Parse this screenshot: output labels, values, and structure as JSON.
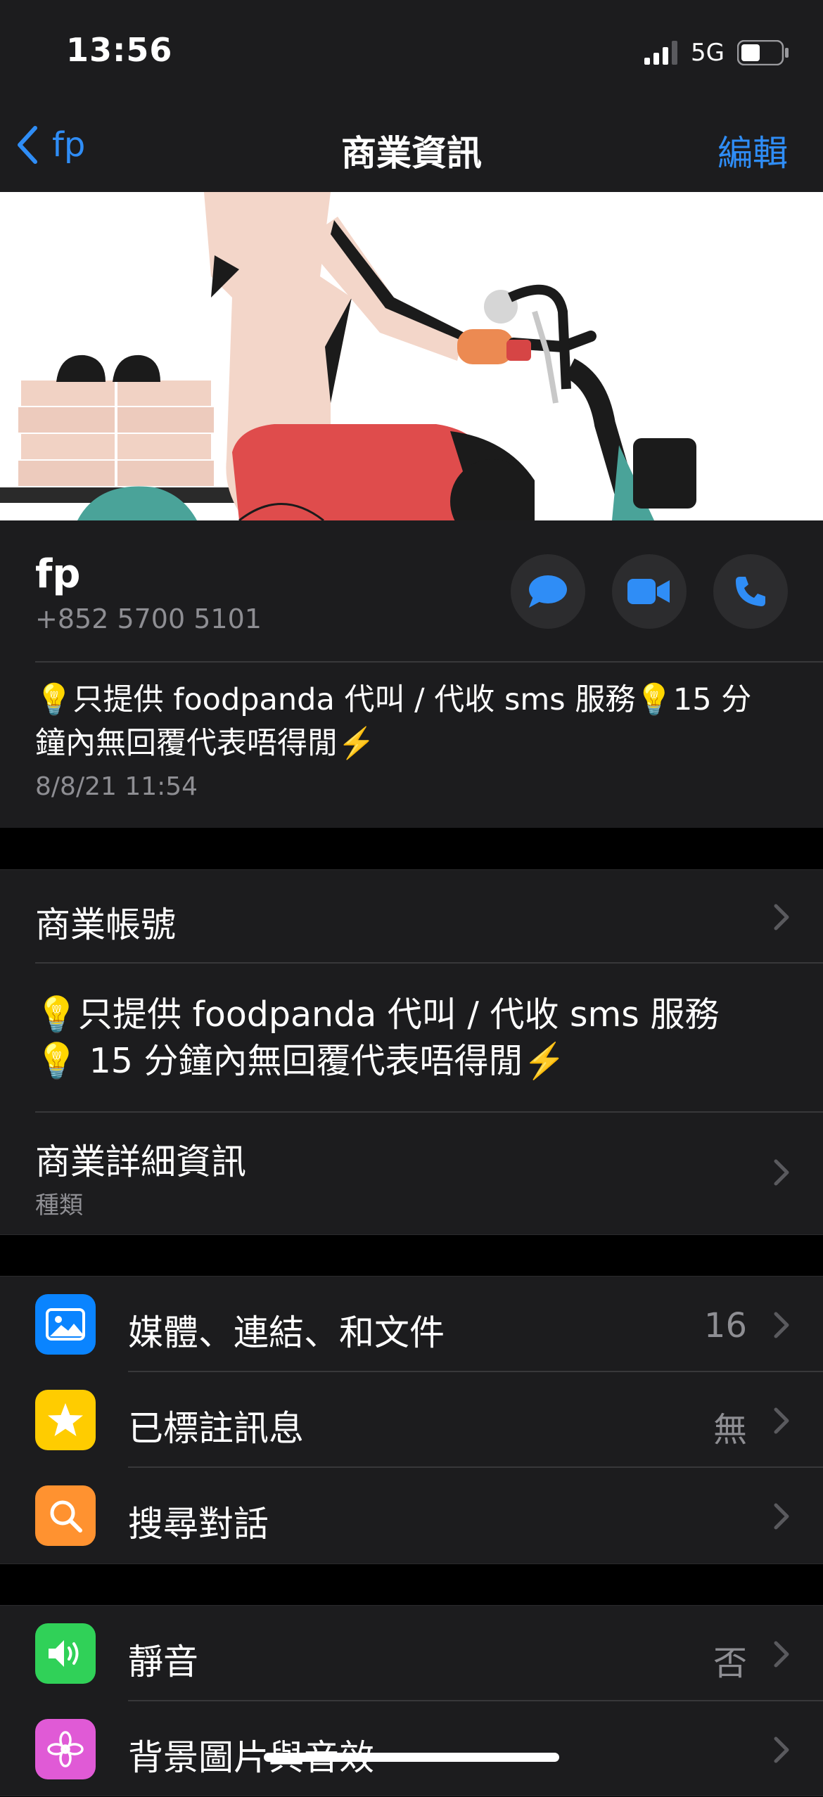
{
  "status_bar": {
    "time": "13:56",
    "network": "5G"
  },
  "nav": {
    "back_label": "fp",
    "title": "商業資訊",
    "edit_label": "編輯"
  },
  "contact": {
    "name": "fp",
    "phone": "+852 5700 5101",
    "about": "💡只提供 foodpanda 代叫 / 代收 sms 服務💡15 分鐘內無回覆代表唔得閒⚡️",
    "about_date": "8/8/21 11:54",
    "actions": [
      "message-icon",
      "video-call-icon",
      "phone-icon"
    ]
  },
  "business": {
    "account_label": "商業帳號",
    "description": "💡只提供 foodpanda 代叫 / 代收 sms 服務💡 15 分鐘內無回覆代表唔得閒⚡️",
    "details_label": "商業詳細資訊",
    "details_sub": "種類"
  },
  "chat_items": [
    {
      "label": "媒體、連結、和文件",
      "value": "16",
      "icon": "photo-icon",
      "color": "#0a84ff"
    },
    {
      "label": "已標註訊息",
      "value": "無",
      "icon": "star-icon",
      "color": "#ffcc00"
    },
    {
      "label": "搜尋對話",
      "value": "",
      "icon": "search-icon",
      "color": "#ff9230"
    }
  ],
  "settings_items": [
    {
      "label": "靜音",
      "value": "否",
      "icon": "speaker-icon",
      "color": "#30d158"
    },
    {
      "label": "背景圖片與音效",
      "value": "",
      "icon": "flower-icon",
      "color": "#e05ad6"
    }
  ],
  "colors": {
    "accent": "#2f8df6",
    "background": "#000000",
    "cell": "#1c1c1e",
    "secondary_text": "#8e8e93"
  }
}
